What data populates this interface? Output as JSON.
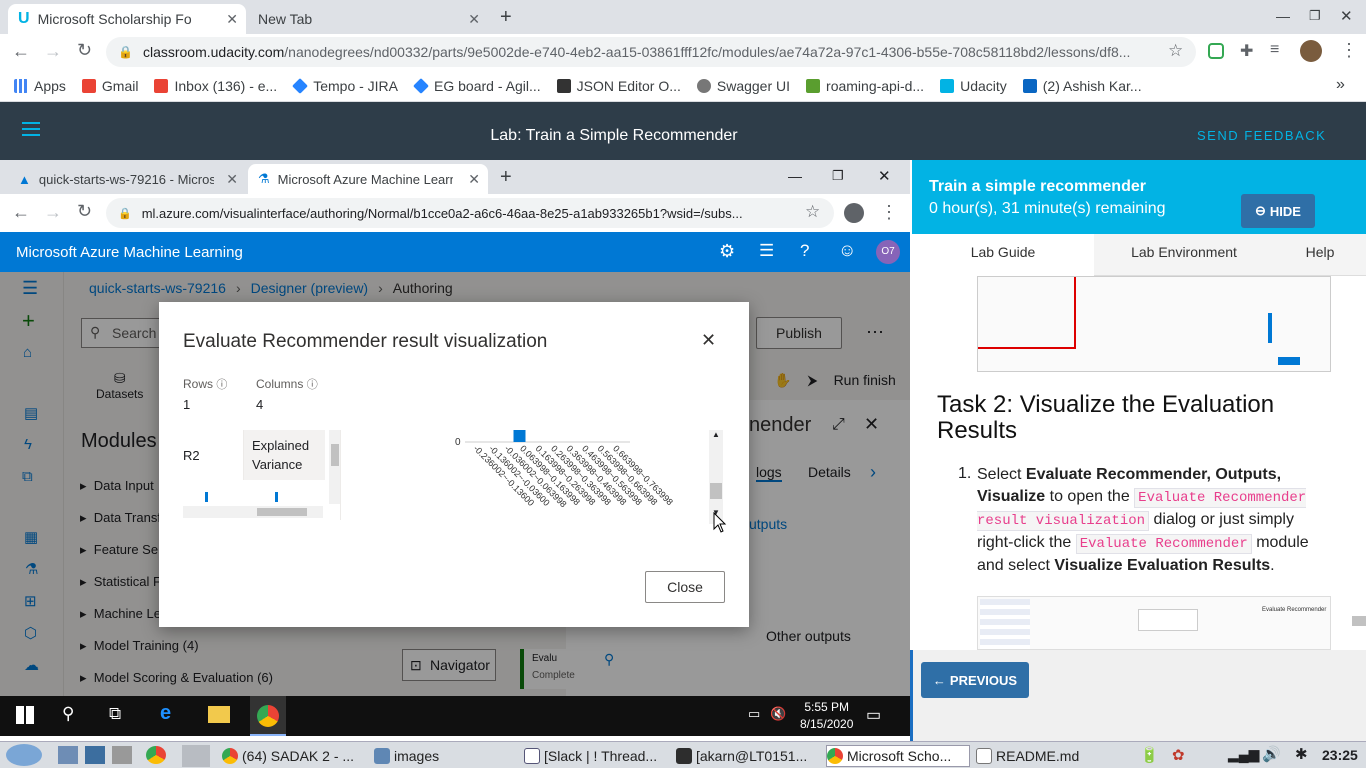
{
  "outer_browser": {
    "tabs": [
      {
        "title": "Microsoft Scholarship Fo",
        "active": true
      },
      {
        "title": "New Tab",
        "active": false
      }
    ],
    "url_host": "classroom.udacity.com",
    "url_path": "/nanodegrees/nd00332/parts/9e5002de-e740-4eb2-aa15-03861fff12fc/modules/ae74a72a-97c1-4306-b55e-708c58118bd2/lessons/df8...",
    "bookmarks": [
      "Apps",
      "Gmail",
      "Inbox (136) - e...",
      "Tempo - JIRA",
      "EG board - Agil...",
      "JSON Editor O...",
      "Swagger UI",
      "roaming-api-d...",
      "Udacity",
      "(2) Ashish Kar..."
    ],
    "bookmark_more": "»"
  },
  "udacity": {
    "title": "Lab: Train a Simple Recommender",
    "feedback": "SEND FEEDBACK"
  },
  "inner_browser": {
    "tabs": [
      {
        "title": "quick-starts-ws-79216 - Microsof",
        "active": false
      },
      {
        "title": "Microsoft Azure Machine Learnin",
        "active": true
      }
    ],
    "url": "ml.azure.com/visualinterface/authoring/Normal/b1cce0a2-a6c6-46aa-8e25-a1ab933265b1?wsid=/subs..."
  },
  "azure": {
    "title": "Microsoft Azure Machine Learning",
    "avatar": "O7",
    "breadcrumb": [
      "quick-starts-ws-79216",
      "Designer (preview)",
      "Authoring"
    ],
    "search_placeholder": "Search",
    "publish": "Publish",
    "more": "⋯",
    "datasets": "Datasets",
    "run_finish": "Run finish",
    "modules_title": "Modules",
    "modules": [
      "Data Input",
      "Data Transf",
      "Feature Sele",
      "Statistical F",
      "Machine Le",
      "Model Training (4)",
      "Model Scoring & Evaluation (6)"
    ],
    "panel_title": "nender",
    "panel_tabs": [
      "logs",
      "Details"
    ],
    "outputs": "utputs",
    "other_outputs": "Other outputs",
    "navigator": "Navigator",
    "node_label": "Evalu",
    "node_status": "Complete"
  },
  "modal": {
    "title": "Evaluate Recommender result visualization",
    "rows_label": "Rows",
    "rows_value": "1",
    "columns_label": "Columns",
    "columns_value": "4",
    "col_headers": [
      "R2",
      "Explained Variance"
    ],
    "close_button": "Close",
    "chart_zero_label": "0",
    "rotated_labels": [
      "-0.236002~-0.13600",
      "-0.136002~-0.03600",
      "-0.036002~0.063998",
      "0.063998~0.163998",
      "0.163998~0.263998",
      "0.263998~0.363998",
      "0.363998~0.463998",
      "0.463998~0.563998",
      "0.563998~0.663998",
      "0.663998~0.763998"
    ]
  },
  "chart_data": {
    "type": "bar",
    "categories": [
      "-0.236002~-0.13600",
      "-0.136002~-0.03600",
      "-0.036002~0.063998",
      "0.063998~0.163998",
      "0.163998~0.263998",
      "0.263998~0.363998",
      "0.363998~0.463998",
      "0.463998~0.563998",
      "0.563998~0.663998",
      "0.663998~0.763998"
    ],
    "values": [
      0,
      0,
      0,
      1,
      0,
      0,
      0,
      0,
      0,
      0
    ],
    "color": "#0078d4"
  },
  "lab_panel": {
    "title": "Train a simple recommender",
    "time_remaining": "0 hour(s), 31 minute(s) remaining",
    "hide_button": "HIDE",
    "tabs": [
      "Lab Guide",
      "Lab Environment",
      "Help"
    ],
    "task_heading": "Task 2: Visualize the Evaluation Results",
    "step_number": "1.",
    "step_select": "Select",
    "step_bold1": "Evaluate Recommender, Outputs, Visualize",
    "step_text1": "to open the",
    "step_code1": "Evaluate Recommender result visualization",
    "step_text2": "dialog or just simply right-click the",
    "step_code2": "Evaluate Recommender",
    "step_text3": "module and select",
    "step_bold2": "Visualize Evaluation Results",
    "step_end": ".",
    "previous_button": "PREVIOUS",
    "thumb_title": "Evaluate Recommender"
  },
  "windows_taskbar": {
    "time": "5:55 PM",
    "date": "8/15/2020"
  },
  "linux_taskbar": {
    "items": [
      "(64) SADAK 2 - ...",
      "images",
      "[Slack | ! Thread...",
      "[akarn@LT0151...",
      "Microsoft Scho...",
      "README.md"
    ],
    "clock": "23:25"
  },
  "colors": {
    "udacity_bar": "#2e3d49",
    "udacity_accent": "#02b3e4",
    "azure_blue": "#0078d4"
  }
}
